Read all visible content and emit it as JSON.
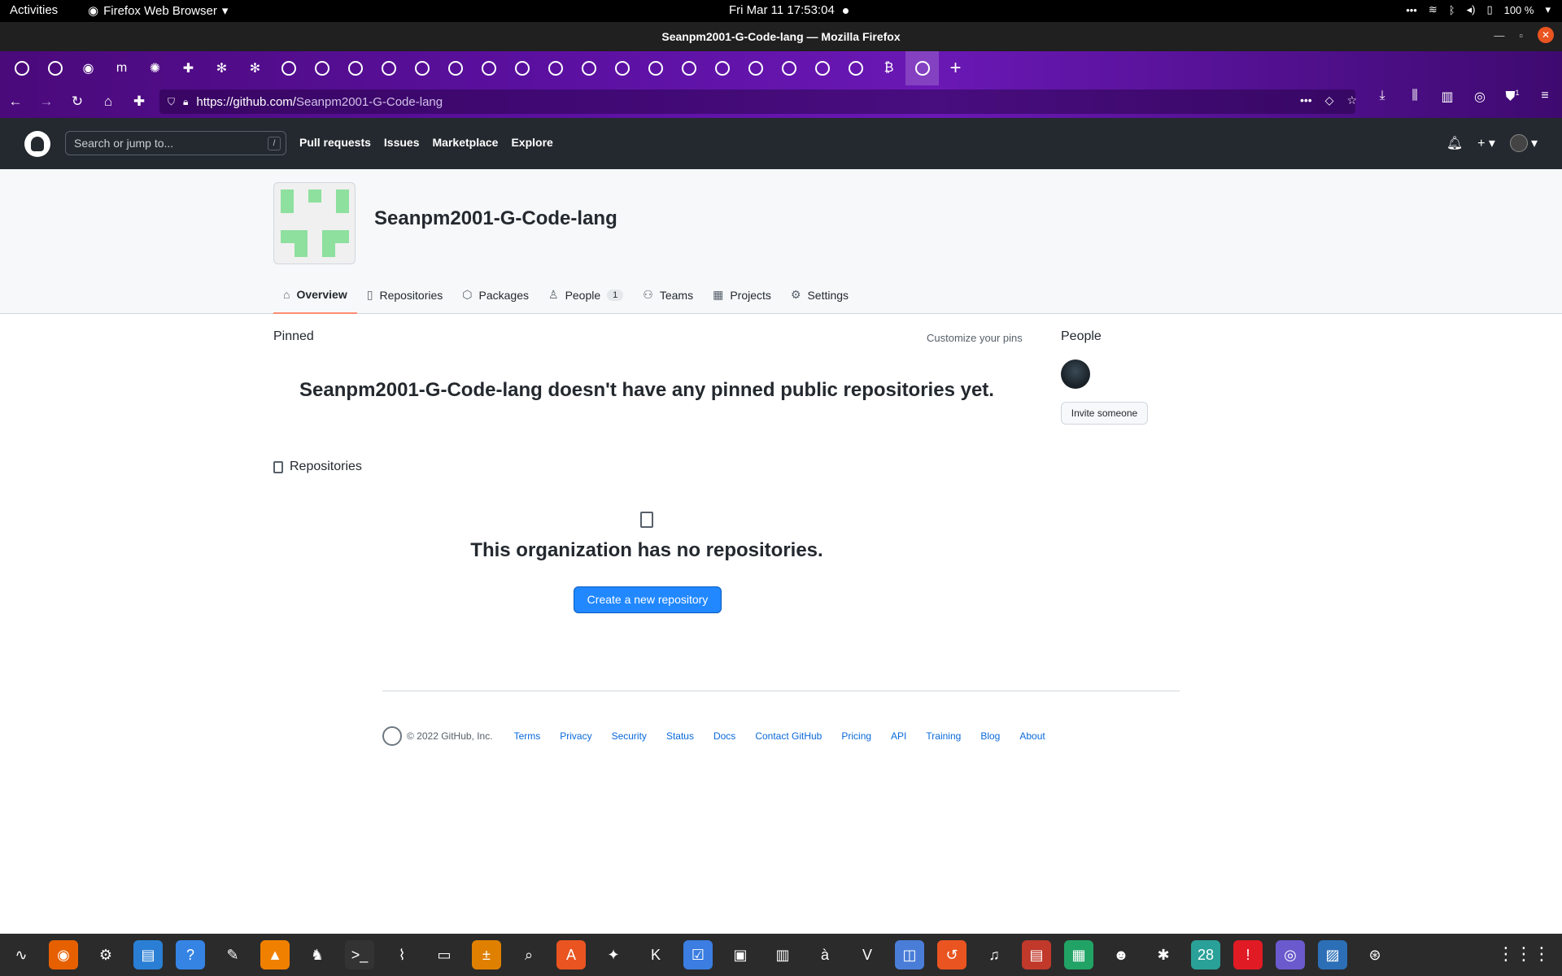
{
  "system": {
    "activities": "Activities",
    "app_name": "Firefox Web Browser",
    "clock": "Fri Mar 11  17:53:04",
    "battery": "100 %"
  },
  "window": {
    "title": "Seanpm2001-G-Code-lang — Mozilla Firefox"
  },
  "tabs": [
    {
      "icon": "github-icon"
    },
    {
      "icon": "github-icon"
    },
    {
      "icon": "firefox-icon"
    },
    {
      "icon": "medium-icon"
    },
    {
      "icon": "gear-icon"
    },
    {
      "icon": "puzzle-icon"
    },
    {
      "icon": "snowflake-icon"
    },
    {
      "icon": "snowflake-icon"
    },
    {
      "icon": "github-icon"
    },
    {
      "icon": "github-icon"
    },
    {
      "icon": "github-icon"
    },
    {
      "icon": "github-icon"
    },
    {
      "icon": "github-icon"
    },
    {
      "icon": "github-icon"
    },
    {
      "icon": "github-icon"
    },
    {
      "icon": "github-icon"
    },
    {
      "icon": "github-icon"
    },
    {
      "icon": "github-icon"
    },
    {
      "icon": "github-icon"
    },
    {
      "icon": "github-icon"
    },
    {
      "icon": "github-icon"
    },
    {
      "icon": "github-icon"
    },
    {
      "icon": "github-icon"
    },
    {
      "icon": "github-icon"
    },
    {
      "icon": "github-icon"
    },
    {
      "icon": "github-icon"
    },
    {
      "icon": "bitcoin-icon"
    },
    {
      "icon": "github-icon",
      "active": true
    }
  ],
  "url": {
    "domain": "https://github.com/",
    "path": "Seanpm2001-G-Code-lang",
    "extension_badge": "1"
  },
  "github": {
    "search_placeholder": "Search or jump to...",
    "search_shortcut": "/",
    "nav": [
      "Pull requests",
      "Issues",
      "Marketplace",
      "Explore"
    ]
  },
  "org": {
    "name": "Seanpm2001-G-Code-lang",
    "avatar_color": "#8ee09f",
    "tabs": [
      {
        "label": "Overview",
        "icon": "home-icon",
        "selected": true
      },
      {
        "label": "Repositories",
        "icon": "repo-icon"
      },
      {
        "label": "Packages",
        "icon": "package-icon"
      },
      {
        "label": "People",
        "icon": "person-icon",
        "count": "1"
      },
      {
        "label": "Teams",
        "icon": "people-icon"
      },
      {
        "label": "Projects",
        "icon": "table-icon"
      },
      {
        "label": "Settings",
        "icon": "gear-icon"
      }
    ]
  },
  "main": {
    "pinned_label": "Pinned",
    "customize_label": "Customize your pins",
    "no_pinned": "Seanpm2001-G-Code-lang doesn't have any pinned public repositories yet.",
    "repos_label": "Repositories",
    "no_repos": "This organization has no repositories.",
    "create_button": "Create a new repository"
  },
  "sidebar": {
    "people_label": "People",
    "invite_button": "Invite someone"
  },
  "footer": {
    "copyright": "© 2022 GitHub, Inc.",
    "links": [
      "Terms",
      "Privacy",
      "Security",
      "Status",
      "Docs",
      "Contact GitHub",
      "Pricing",
      "API",
      "Training",
      "Blog",
      "About"
    ]
  },
  "dock": {
    "apps": [
      "system-monitor-icon",
      "firefox-icon",
      "settings-icon",
      "writer-icon",
      "help-icon",
      "text-editor-icon",
      "vlc-icon",
      "chess-icon",
      "terminal-icon",
      "graph-icon",
      "files-icon",
      "calculator-icon",
      "search-icon",
      "software-center-icon",
      "inkscape-icon",
      "kate-icon",
      "tasks-icon",
      "screenshot-icon",
      "archive-icon",
      "character-map-icon",
      "vim-icon",
      "remote-desktop-icon",
      "backup-icon",
      "music-icon",
      "pdf-icon",
      "spreadsheet-icon",
      "mario-icon",
      "bug-icon",
      "calendar-icon",
      "alert-icon",
      "screen-recorder-icon",
      "photos-icon",
      "launcher-icon"
    ],
    "calendar_day": "28"
  },
  "colors": {
    "header_bg": "#24292f",
    "accent": "#2188ff",
    "tab_underline": "#fd8c73"
  }
}
